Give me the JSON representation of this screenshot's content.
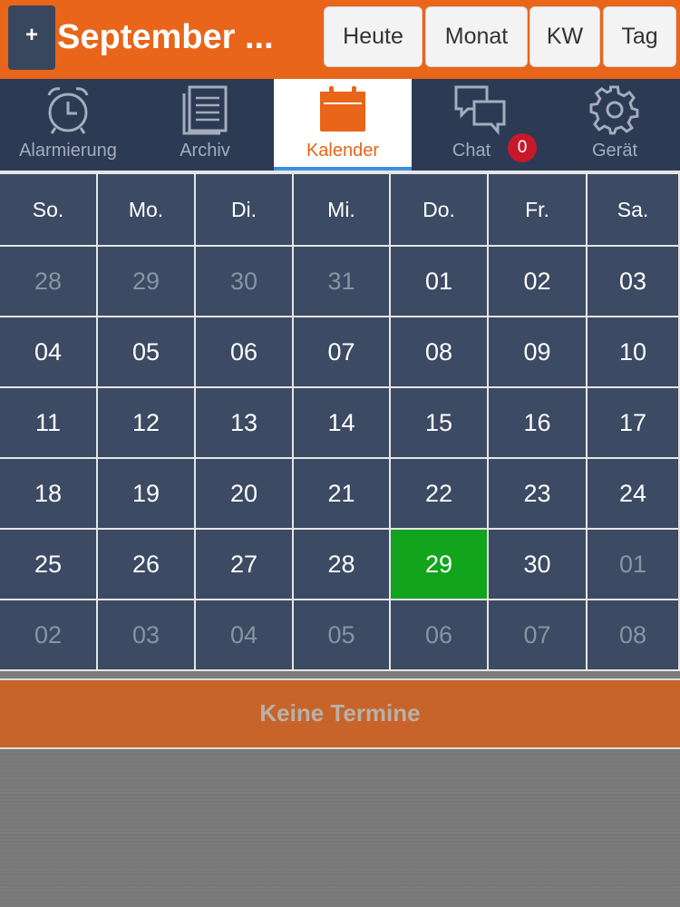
{
  "header": {
    "add_label": "+",
    "title": "September ...",
    "buttons": [
      "Heute",
      "Monat",
      "KW",
      "Tag"
    ]
  },
  "tabs": [
    {
      "label": "Alarmierung",
      "icon": "alarm-clock-icon"
    },
    {
      "label": "Archiv",
      "icon": "archive-list-icon"
    },
    {
      "label": "Kalender",
      "icon": "calendar-icon",
      "active": true
    },
    {
      "label": "Chat",
      "icon": "chat-bubbles-icon",
      "badge": "0"
    },
    {
      "label": "Gerät",
      "icon": "gear-icon"
    }
  ],
  "calendar": {
    "weekdays": [
      "So.",
      "Mo.",
      "Di.",
      "Mi.",
      "Do.",
      "Fr.",
      "Sa."
    ],
    "weeks": [
      [
        "28",
        "29",
        "30",
        "31",
        "01",
        "02",
        "03"
      ],
      [
        "04",
        "05",
        "06",
        "07",
        "08",
        "09",
        "10"
      ],
      [
        "11",
        "12",
        "13",
        "14",
        "15",
        "16",
        "17"
      ],
      [
        "18",
        "19",
        "20",
        "21",
        "22",
        "23",
        "24"
      ],
      [
        "25",
        "26",
        "27",
        "28",
        "29",
        "30",
        "01"
      ],
      [
        "02",
        "03",
        "04",
        "05",
        "06",
        "07",
        "08"
      ]
    ],
    "other_month": [
      [
        true,
        true,
        true,
        true,
        false,
        false,
        false
      ],
      [
        false,
        false,
        false,
        false,
        false,
        false,
        false
      ],
      [
        false,
        false,
        false,
        false,
        false,
        false,
        false
      ],
      [
        false,
        false,
        false,
        false,
        false,
        false,
        false
      ],
      [
        false,
        false,
        false,
        false,
        false,
        false,
        true
      ],
      [
        true,
        true,
        true,
        true,
        true,
        true,
        true
      ]
    ],
    "today": {
      "week": 4,
      "day": 4
    }
  },
  "events": {
    "empty_label": "Keine Termine"
  },
  "colors": {
    "accent": "#e8651a",
    "navy": "#2c3a54",
    "cell": "#3c4a63",
    "today": "#12a41c",
    "badge": "#c8192b"
  }
}
